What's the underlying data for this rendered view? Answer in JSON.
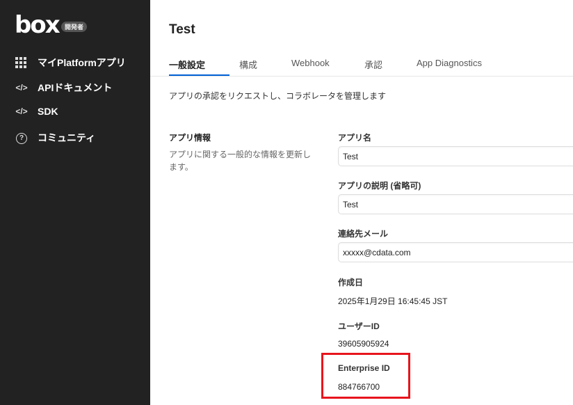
{
  "sidebar": {
    "logo": "box",
    "badge": "開発者",
    "items": [
      {
        "label": "マイPlatformアプリ",
        "icon": "grid-icon"
      },
      {
        "label": "APIドキュメント",
        "icon": "code-icon"
      },
      {
        "label": "SDK",
        "icon": "code-icon"
      },
      {
        "label": "コミュニティ",
        "icon": "question-circle-icon"
      }
    ]
  },
  "page": {
    "title": "Test",
    "tabs": [
      "一般設定",
      "構成",
      "Webhook",
      "承認",
      "App Diagnostics"
    ],
    "active_tab": "一般設定",
    "description": "アプリの承認をリクエストし、コラボレータを管理します"
  },
  "section": {
    "title": "アプリ情報",
    "description": "アプリに関する一般的な情報を更新します。"
  },
  "fields": {
    "app_name": {
      "label": "アプリ名",
      "value": "Test"
    },
    "app_desc": {
      "label": "アプリの説明 (省略可)",
      "value": "Test"
    },
    "email": {
      "label": "連絡先メール",
      "value": "xxxxx@cdata.com"
    },
    "created": {
      "label": "作成日",
      "value": "2025年1月29日 16:45:45 JST"
    },
    "user_id": {
      "label": "ユーザーID",
      "value": "39605905924"
    },
    "enterprise_id": {
      "label": "Enterprise ID",
      "value": "884766700"
    }
  },
  "highlight_color": "#e8141c"
}
